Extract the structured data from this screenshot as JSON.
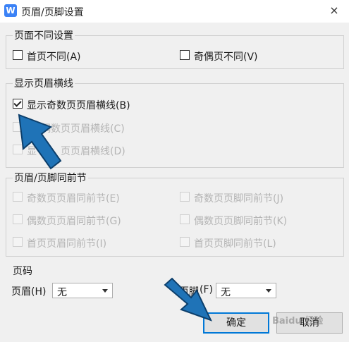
{
  "window": {
    "title": "页眉/页脚设置",
    "app_icon": "W",
    "close_icon": "×"
  },
  "group_diff": {
    "title": "页面不同设置",
    "first_page": {
      "label": "首页不同(A)",
      "checked": false,
      "enabled": true
    },
    "odd_even": {
      "label": "奇偶页不同(V)",
      "checked": false,
      "enabled": true
    }
  },
  "group_lines": {
    "title": "显示页眉横线",
    "odd_line": {
      "label": "显示奇数页页眉横线(B)",
      "checked": true,
      "enabled": true
    },
    "even_line": {
      "label": "偶数页页眉横线(C)",
      "checked": false,
      "enabled": false
    },
    "first_line": {
      "label": "显",
      "label2": "页页眉横线(D)",
      "checked": false,
      "enabled": false
    }
  },
  "group_section": {
    "title": "页眉/页脚同前节",
    "odd_header": {
      "label": "奇数页页眉同前节(E)",
      "enabled": false
    },
    "odd_footer": {
      "label": "奇数页页脚同前节(J)",
      "enabled": false
    },
    "even_header": {
      "label": "偶数页页眉同前节(G)",
      "enabled": false
    },
    "even_footer": {
      "label": "偶数页页脚同前节(K)",
      "enabled": false
    },
    "first_header": {
      "label": "首页页眉同前节(I)",
      "enabled": false
    },
    "first_footer": {
      "label": "首页页脚同前节(L)",
      "enabled": false
    }
  },
  "group_page_number": {
    "title": "页码",
    "header_label": "页眉(H)",
    "header_value": "无",
    "footer_label_a": "页脚",
    "footer_label_b": "(F)",
    "footer_value": "无"
  },
  "buttons": {
    "ok": "确定",
    "cancel": "取消"
  },
  "watermark": "Baidu 经验",
  "colors": {
    "arrow": "#1f73b7",
    "accent": "#0078d7"
  }
}
